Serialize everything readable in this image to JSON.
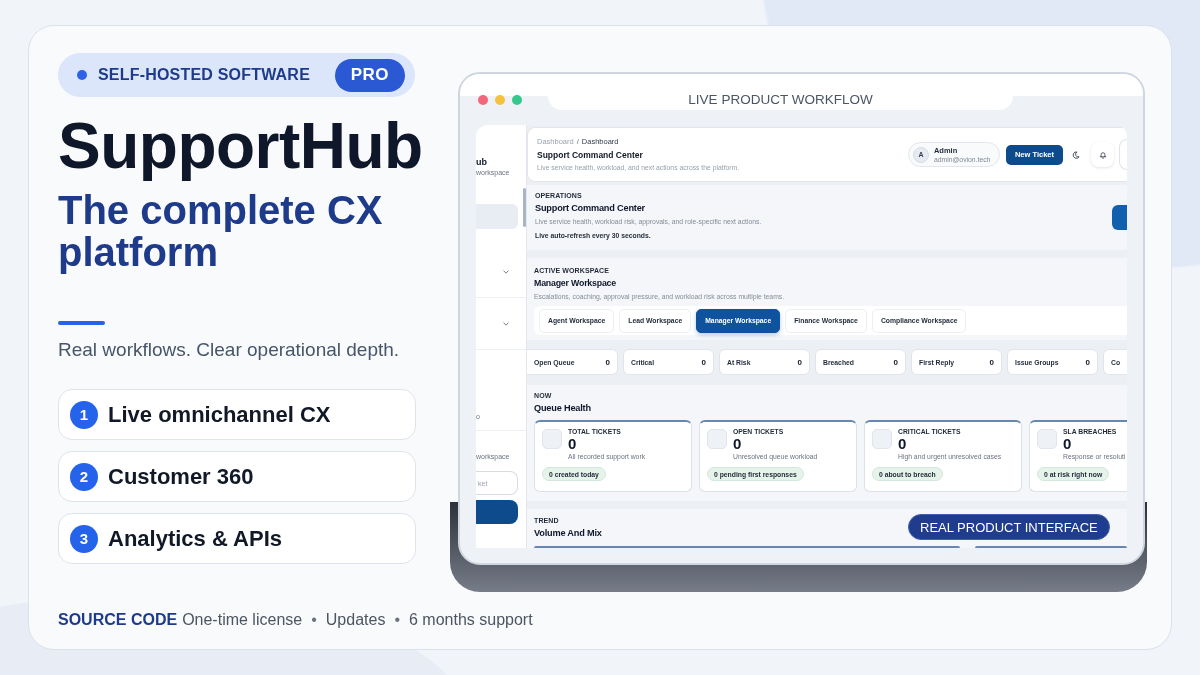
{
  "badge": {
    "label": "SELF-HOSTED SOFTWARE",
    "tag": "PRO"
  },
  "hero": {
    "title": "SupportHub",
    "subtitle": "The complete CX platform",
    "tagline": "Real workflows. Clear operational depth."
  },
  "features": [
    {
      "number": "1",
      "label": "Live omnichannel CX"
    },
    {
      "number": "2",
      "label": "Customer 360"
    },
    {
      "number": "3",
      "label": "Analytics & APIs"
    }
  ],
  "footer": {
    "lead": "SOURCE CODE",
    "items": [
      {
        "kind": "text",
        "text": "One-time license"
      },
      {
        "kind": "separator",
        "text": "•"
      },
      {
        "kind": "text",
        "text": "Updates"
      },
      {
        "kind": "separator",
        "text": "•"
      },
      {
        "kind": "text",
        "text": "6 months support"
      }
    ]
  },
  "preview": {
    "window_title": "LIVE PRODUCT WORKFLOW",
    "overlay_label": "REAL PRODUCT INTERFACE",
    "sidebar": {
      "brand": "ub",
      "brand_caption": "workspace",
      "nav": [
        {
          "selected": true
        }
      ],
      "groups": [
        {
          "expanded": false
        },
        {
          "expanded": false
        }
      ],
      "note": "o",
      "section_caption": "workspace",
      "field": {
        "placeholder": "ket"
      }
    },
    "header": {
      "breadcrumb": [
        "Dashboard",
        "Dashboard"
      ],
      "breadcrumb_separator": "/",
      "title": "Support Command Center",
      "subtitle": "Live service health, workload, and next actions across the platform.",
      "user": {
        "initial": "A",
        "name": "Admin",
        "email": "admin@ovion.tech"
      },
      "action": "New Ticket"
    },
    "operations": {
      "eyebrow": "OPERATIONS",
      "title": "Support Command Center",
      "description": "Live service health, workload risk, approvals, and role-specific next actions.",
      "note": "Live auto-refresh every 30 seconds."
    },
    "workspace": {
      "eyebrow": "ACTIVE WORKSPACE",
      "title": "Manager Workspace",
      "description": "Escalations, coaching, approval pressure, and workload risk across multiple teams.",
      "tabs": [
        {
          "label": "Agent Workspace",
          "selected": false
        },
        {
          "label": "Lead Workspace",
          "selected": false
        },
        {
          "label": "Manager Workspace",
          "selected": true
        },
        {
          "label": "Finance Workspace",
          "selected": false
        },
        {
          "label": "Compliance Workspace",
          "selected": false
        }
      ]
    },
    "kpis": [
      {
        "label": "Open Queue",
        "value": "0"
      },
      {
        "label": "Critical",
        "value": "0"
      },
      {
        "label": "At Risk",
        "value": "0"
      },
      {
        "label": "Breached",
        "value": "0"
      },
      {
        "label": "First Reply",
        "value": "0"
      },
      {
        "label": "Issue Groups",
        "value": "0"
      },
      {
        "label": "Co"
      }
    ],
    "queue_health": {
      "eyebrow": "NOW",
      "title": "Queue Health",
      "cards": [
        {
          "label": "TOTAL TICKETS",
          "value": "0",
          "caption": "All recorded support work",
          "chip": "0 created today"
        },
        {
          "label": "OPEN TICKETS",
          "value": "0",
          "caption": "Unresolved queue workload",
          "chip": "0 pending first responses"
        },
        {
          "label": "CRITICAL TICKETS",
          "value": "0",
          "caption": "High and urgent unresolved cases",
          "chip": "0 about to breach"
        },
        {
          "label": "SLA BREACHES",
          "value": "0",
          "caption": "Response or resoluti",
          "chip": "0 at risk right now"
        }
      ]
    },
    "trend": {
      "eyebrow": "TREND",
      "title": "Volume And Mix"
    }
  }
}
